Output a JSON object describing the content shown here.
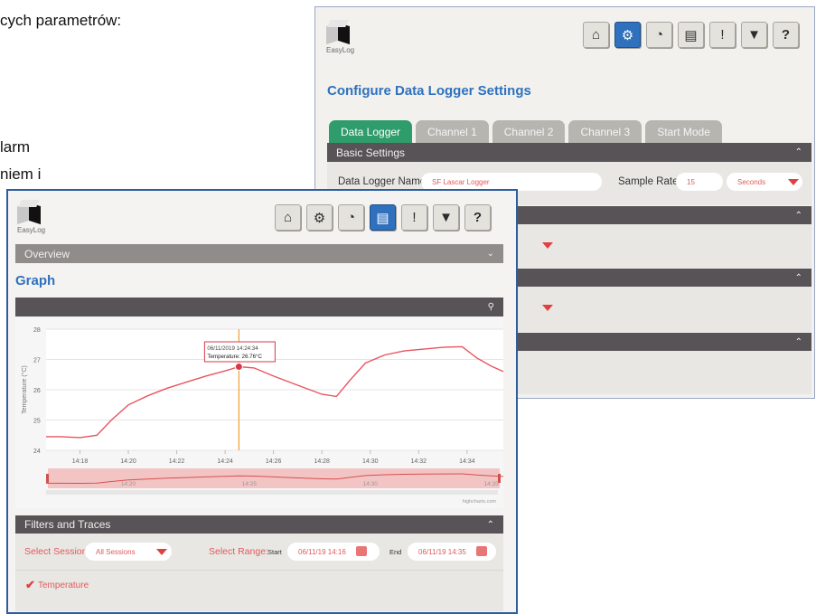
{
  "background_text": {
    "line1": "cych parametrów:",
    "line2": "larm",
    "line3": "niem i"
  },
  "settings_window": {
    "logo_text": "EasyLog",
    "title": "Configure Data Logger Settings",
    "tabs": [
      "Data Logger",
      "Channel 1",
      "Channel 2",
      "Channel 3",
      "Start Mode"
    ],
    "active_tab": "Data Logger",
    "basic_settings_label": "Basic Settings",
    "data_logger_name_label": "Data Logger Name",
    "data_logger_name_value": "SF Lascar Logger",
    "sample_rate_label": "Sample Rate",
    "sample_rate_value": "15",
    "sample_rate_unit": "Seconds",
    "toolbar_icons": [
      "home-icon",
      "gear-icon",
      "gauge-icon",
      "graph-icon",
      "alarm-icon",
      "download-icon",
      "help-icon"
    ],
    "active_icon": "gear-icon"
  },
  "graph_window": {
    "logo_text": "EasyLog",
    "overview_label": "Overview",
    "title": "Graph",
    "toolbar_icons": [
      "home-icon",
      "gear-icon",
      "gauge-icon",
      "graph-icon",
      "alarm-icon",
      "download-icon",
      "help-icon"
    ],
    "active_icon": "graph-icon",
    "tooltip_time": "06/11/2019 14:24:34",
    "tooltip_value": "Temperature: 26.76°C",
    "credit": "highcharts.com",
    "filters_label": "Filters and Traces",
    "select_session_label": "Select Session:",
    "session_value": "All Sessions",
    "select_range_label": "Select Range:",
    "start_label": "Start",
    "start_value": "06/11/19 14:16",
    "end_label": "End",
    "end_value": "06/11/19 14:35",
    "trace_label": "Temperature",
    "trace_checked": true
  },
  "chart_data": {
    "type": "line",
    "ylabel": "Temperature (°C)",
    "ylim": [
      24,
      28
    ],
    "y_ticks": [
      "24",
      "25",
      "26",
      "27",
      "28"
    ],
    "x_ticks": [
      "14:18",
      "14:20",
      "14:22",
      "14:24",
      "14:26",
      "14:28",
      "14:30",
      "14:32",
      "14:34"
    ],
    "x_tick_minutes": [
      18,
      20,
      22,
      24,
      26,
      28,
      30,
      32,
      34
    ],
    "xlim_minutes": [
      16.6,
      35.5
    ],
    "navigator_ticks": [
      "14:20",
      "14:25",
      "14:30",
      "14:35"
    ],
    "navigator_tick_minutes": [
      20,
      25,
      30,
      35
    ],
    "crosshair_minute": 24.57,
    "series": [
      {
        "name": "Temperature",
        "color": "#e8545f",
        "x_minutes": [
          16.6,
          17.2,
          18.0,
          18.7,
          19.3,
          20.0,
          20.8,
          21.6,
          22.4,
          23.2,
          24.0,
          24.57,
          25.2,
          26.0,
          27.0,
          28.0,
          28.6,
          29.2,
          29.8,
          30.6,
          31.4,
          32.2,
          33.0,
          33.8,
          34.4,
          35.0,
          35.5
        ],
        "values": [
          24.45,
          24.45,
          24.42,
          24.5,
          25.0,
          25.5,
          25.8,
          26.05,
          26.25,
          26.45,
          26.62,
          26.76,
          26.72,
          26.45,
          26.15,
          25.85,
          25.78,
          26.35,
          26.88,
          27.15,
          27.28,
          27.34,
          27.4,
          27.42,
          27.05,
          26.78,
          26.6
        ]
      }
    ]
  }
}
